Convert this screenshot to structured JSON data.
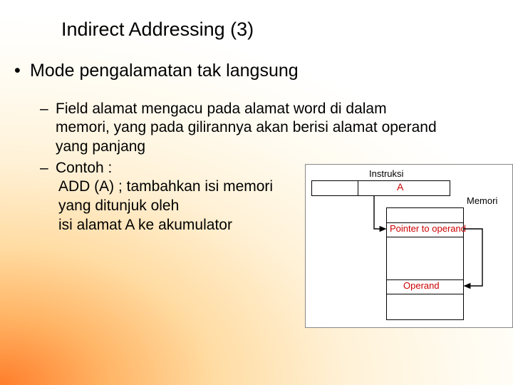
{
  "title": "Indirect Addressing (3)",
  "bullet1": "Mode pengalamatan tak langsung",
  "sub1": "Field alamat mengacu pada alamat word di dalam memori, yang pada gilirannya akan berisi alamat operand yang panjang",
  "sub2": "Contoh :",
  "line1": "ADD (A) ; tambahkan isi memori",
  "line2": "yang ditunjuk oleh",
  "line3": "isi alamat A ke akumulator",
  "diagram": {
    "instr_label": "Instruksi",
    "a": "A",
    "memori": "Memori",
    "pointer": "Pointer to operand",
    "operand": "Operand"
  }
}
